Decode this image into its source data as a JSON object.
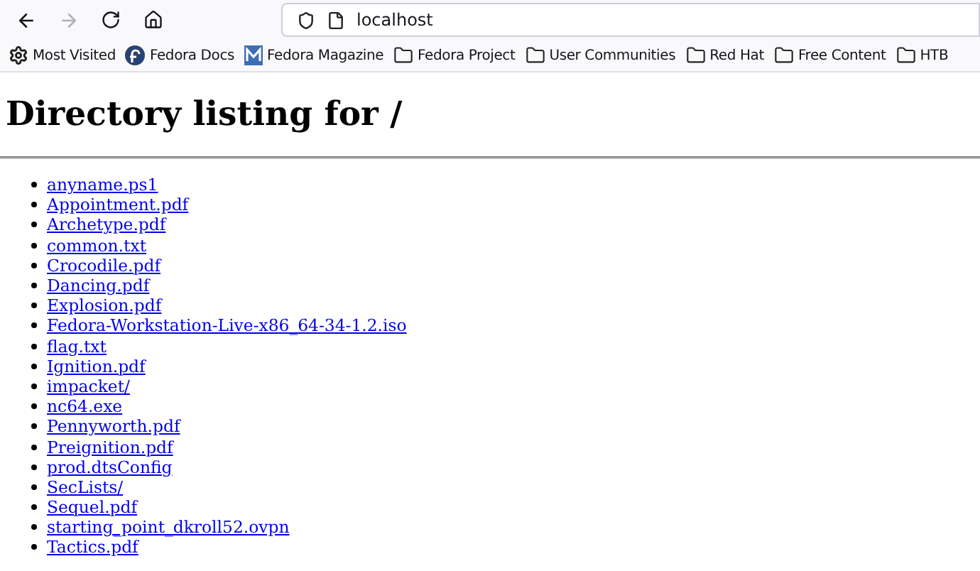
{
  "toolbar": {
    "back": {
      "disabled": false
    },
    "forward": {
      "disabled": true
    },
    "address": "localhost"
  },
  "bookmarks": [
    {
      "kind": "settings",
      "label": "Most Visited"
    },
    {
      "kind": "fedora",
      "label": "Fedora Docs"
    },
    {
      "kind": "magazine",
      "label": "Fedora Magazine"
    },
    {
      "kind": "folder",
      "label": "Fedora Project"
    },
    {
      "kind": "folder",
      "label": "User Communities"
    },
    {
      "kind": "folder",
      "label": "Red Hat"
    },
    {
      "kind": "folder",
      "label": "Free Content"
    },
    {
      "kind": "folder",
      "label": "HTB"
    }
  ],
  "page": {
    "heading": "Directory listing for /",
    "files": [
      "anyname.ps1",
      "Appointment.pdf",
      "Archetype.pdf",
      "common.txt",
      "Crocodile.pdf",
      "Dancing.pdf",
      "Explosion.pdf",
      "Fedora-Workstation-Live-x86_64-34-1.2.iso",
      "flag.txt",
      "Ignition.pdf",
      "impacket/",
      "nc64.exe",
      "Pennyworth.pdf",
      "Preignition.pdf",
      "prod.dtsConfig",
      "SecLists/",
      "Sequel.pdf",
      "starting_point_dkroll52.ovpn",
      "Tactics.pdf"
    ]
  }
}
